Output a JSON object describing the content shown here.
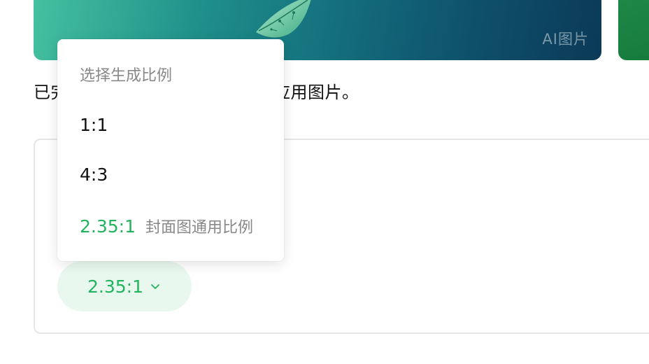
{
  "hero": {
    "caption": "AI图片"
  },
  "status_text": "已完成生成，可选择比例或直接应用图片。",
  "ratio_menu": {
    "title": "选择生成比例",
    "options": [
      {
        "label": "1:1",
        "note": ""
      },
      {
        "label": "4:3",
        "note": ""
      },
      {
        "label": "2.35:1",
        "note": "封面图通用比例",
        "selected": true
      }
    ]
  },
  "ratio_button": {
    "label": "2.35:1",
    "icon": "chevron-down-icon"
  },
  "colors": {
    "accent": "#22b35e",
    "accent_bg": "#e9f8ee",
    "muted_text": "#888888",
    "panel_border": "#e6e6e6"
  }
}
